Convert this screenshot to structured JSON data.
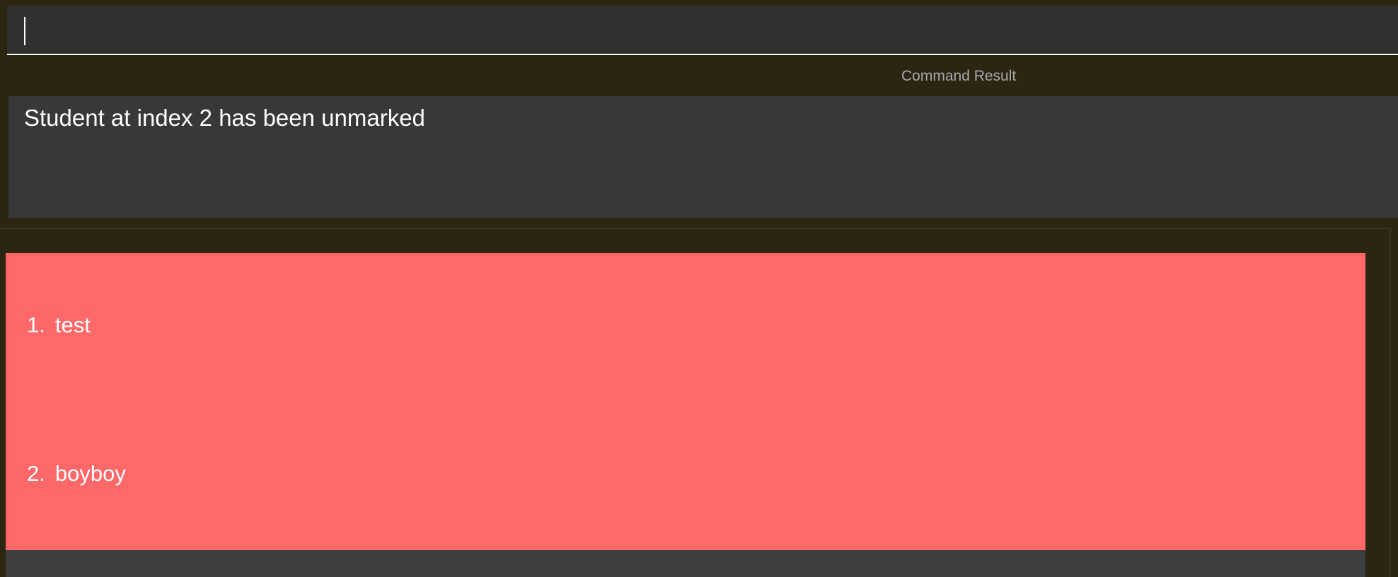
{
  "command_input": {
    "value": ""
  },
  "result": {
    "label": "Command Result",
    "message": "Student at index 2 has been unmarked"
  },
  "students": [
    {
      "index": "1.",
      "name": "test"
    },
    {
      "index": "2.",
      "name": "boyboy"
    }
  ],
  "colors": {
    "background": "#2b2512",
    "input_bg": "#303030",
    "result_bg": "#383838",
    "list_bg": "#3c3e40",
    "unmarked_item": "#ff6868",
    "text": "#ffffff",
    "label_text": "#a8a8a8"
  }
}
